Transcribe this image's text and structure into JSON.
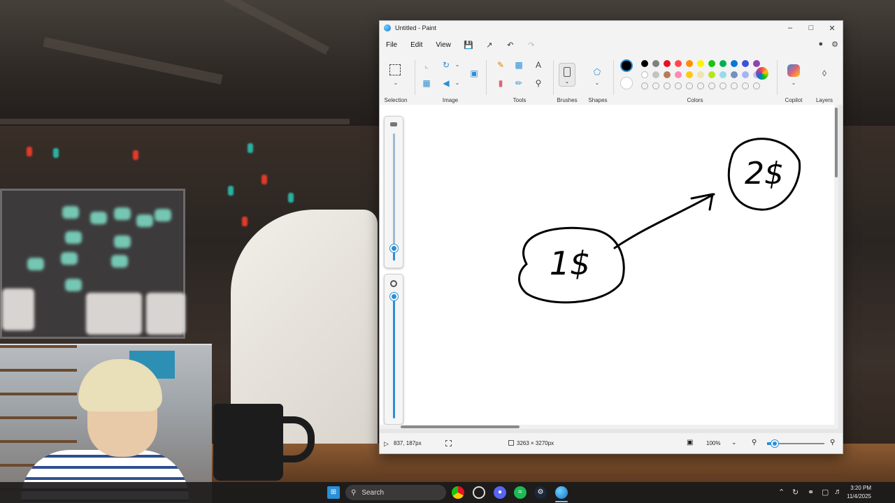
{
  "paint": {
    "title": "Untitled - Paint",
    "window_controls": {
      "minimize": "–",
      "maximize": "□",
      "close": "✕"
    },
    "menu": {
      "file": "File",
      "edit": "Edit",
      "view": "View"
    },
    "ribbon": {
      "selection": "Selection",
      "image": "Image",
      "tools": "Tools",
      "brushes": "Brushes",
      "shapes": "Shapes",
      "colors": "Colors",
      "copilot": "Copilot",
      "layers": "Layers"
    },
    "palette": {
      "primary": "#000000",
      "secondary": "#ffffff",
      "row1": [
        "#000000",
        "#7f7f7f",
        "#e81123",
        "#ff4a4a",
        "#ff8c00",
        "#fff100",
        "#16c60c",
        "#00b050",
        "#0078d7",
        "#3f51d8",
        "#8e44ad"
      ],
      "row2": [
        "#ffffff",
        "#c3c3c3",
        "#b97a57",
        "#ff8ab4",
        "#ffc90e",
        "#efe4b0",
        "#b5e61d",
        "#99d9ea",
        "#7092be",
        "#a7b4f0",
        "#c8bfe7"
      ]
    },
    "drawing": {
      "left_bubble_text": "1$",
      "right_bubble_text": "2$"
    },
    "status": {
      "cursor_position": "837, 187px",
      "canvas_size": "3263 × 3270px",
      "zoom": "100%"
    }
  },
  "taskbar": {
    "search_label": "Search",
    "time": "3:20 PM",
    "date": "11/4/2025"
  }
}
